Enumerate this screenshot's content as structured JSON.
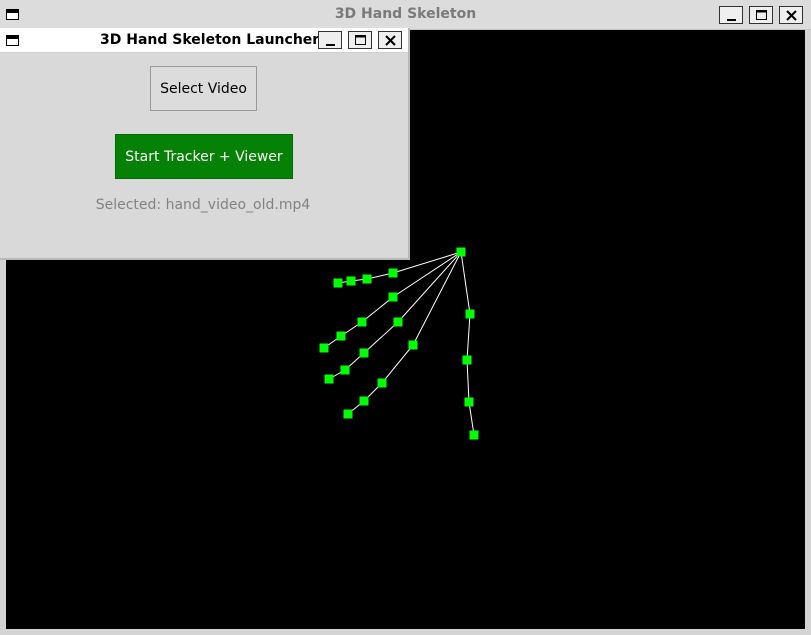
{
  "main_window": {
    "title": "3D Hand Skeleton"
  },
  "launcher": {
    "title": "3D Hand Skeleton Launcher",
    "select_label": "Select Video",
    "start_label": "Start Tracker + Viewer",
    "selected_text": "Selected: hand_video_old.mp4",
    "start_color": "#058205"
  },
  "skeleton": {
    "joint_color": "#00ff00",
    "bone_color": "#ffffff",
    "background": "#000000"
  },
  "icons": {
    "window_menu": "window-menu-icon",
    "minimize": "minimize-icon",
    "maximize": "maximize-icon",
    "close": "close-icon"
  }
}
